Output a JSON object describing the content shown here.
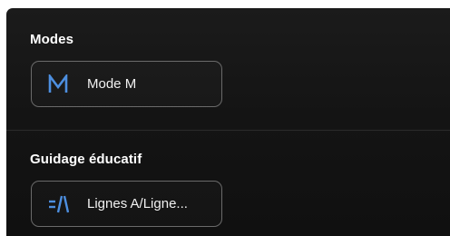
{
  "sections": {
    "modes": {
      "title": "Modes",
      "button": {
        "label": "Mode M",
        "icon": "letter-m-icon"
      }
    },
    "guidage": {
      "title": "Guidage éducatif",
      "button": {
        "label": "Lignes A/Ligne...",
        "icon": "lane-lines-icon"
      }
    }
  },
  "colors": {
    "accent": "#4d8fe0",
    "text": "#f1f1f1",
    "border": "#6a6a6a",
    "background": "#151515"
  }
}
